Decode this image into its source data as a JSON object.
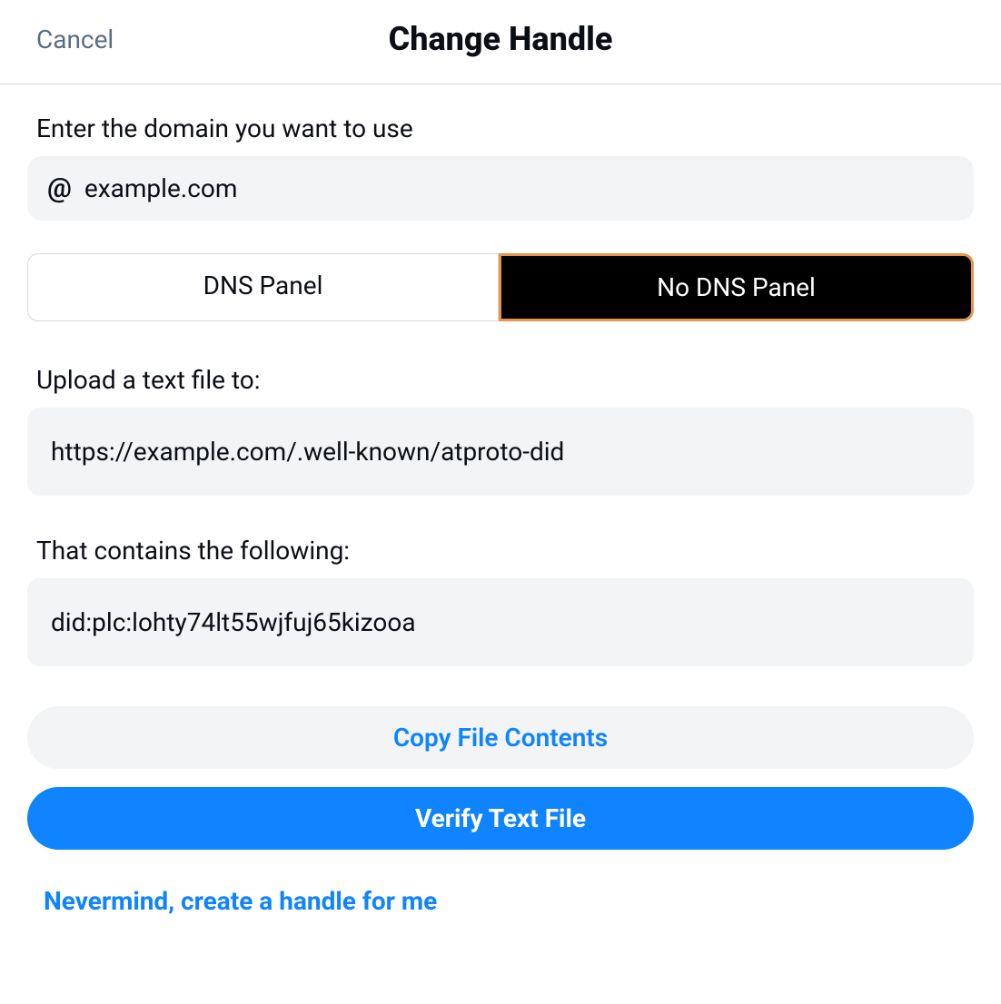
{
  "header": {
    "cancel_label": "Cancel",
    "title": "Change Handle"
  },
  "form": {
    "domain_label": "Enter the domain you want to use",
    "at_symbol": "@",
    "domain_value": "example.com",
    "domain_placeholder": "example.com"
  },
  "tabs": {
    "dns_panel_label": "DNS Panel",
    "no_dns_panel_label": "No DNS Panel"
  },
  "upload": {
    "label": "Upload a text file to:",
    "url": "https://example.com/.well-known/atproto-did"
  },
  "contents": {
    "label": "That contains the following:",
    "value": "did:plc:lohty74lt55wjfuj65kizooa"
  },
  "buttons": {
    "copy_label": "Copy File Contents",
    "verify_label": "Verify Text File",
    "nevermind_label": "Nevermind, create a handle for me"
  }
}
